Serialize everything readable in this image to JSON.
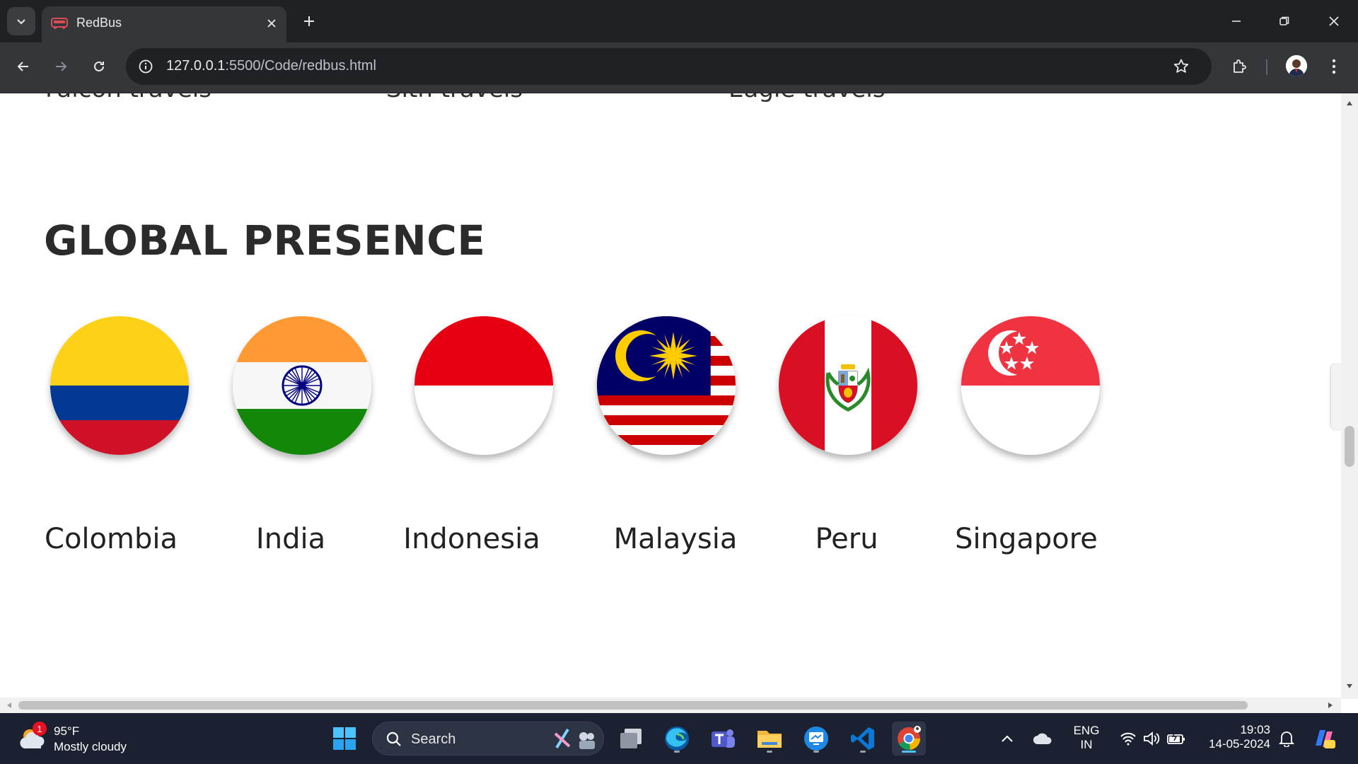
{
  "browser": {
    "tab_title": "RedBus",
    "url_host": "127.0.0.1",
    "url_path": ":5500/Code/redbus.html"
  },
  "page": {
    "cut_off_items": [
      "Falcon travels",
      "Sith travels",
      "Eagle travels"
    ],
    "section_title": "GLOBAL PRESENCE",
    "countries": [
      {
        "name": "Colombia",
        "flag": "colombia-flag-icon"
      },
      {
        "name": "India",
        "flag": "india-flag-icon"
      },
      {
        "name": "Indonesia",
        "flag": "indonesia-flag-icon"
      },
      {
        "name": "Malaysia",
        "flag": "malaysia-flag-icon"
      },
      {
        "name": "Peru",
        "flag": "peru-flag-icon"
      },
      {
        "name": "Singapore",
        "flag": "singapore-flag-icon"
      }
    ]
  },
  "taskbar": {
    "weather_temp": "95°F",
    "weather_desc": "Mostly cloudy",
    "weather_badge": "1",
    "search_placeholder": "Search",
    "lang_line1": "ENG",
    "lang_line2": "IN",
    "time": "19:03",
    "date": "14-05-2024"
  }
}
